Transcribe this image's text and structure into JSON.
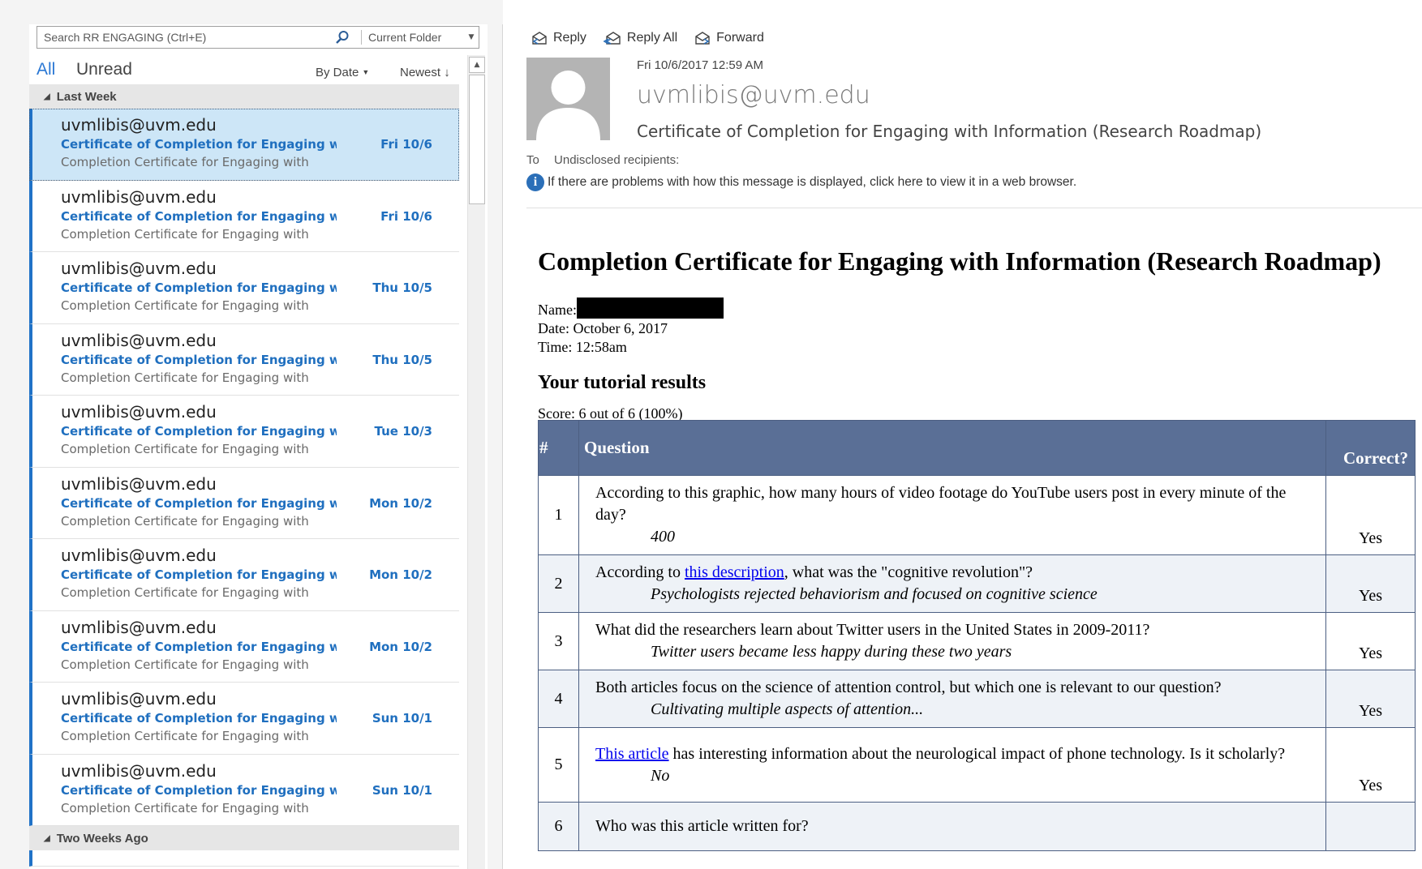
{
  "search": {
    "placeholder": "Search RR ENGAGING (Ctrl+E)",
    "scope": "Current Folder"
  },
  "filters": {
    "all": "All",
    "unread": "Unread",
    "sort_by": "By Date",
    "sort_order": "Newest"
  },
  "groups": {
    "last_week": "Last Week",
    "two_weeks_ago": "Two Weeks Ago"
  },
  "messages": [
    {
      "sender": "uvmlibis@uvm.edu",
      "subject": "Certificate of Completion for Engaging with I...",
      "date": "Fri 10/6",
      "preview": "Completion Certificate for Engaging with"
    },
    {
      "sender": "uvmlibis@uvm.edu",
      "subject": "Certificate of Completion for Engaging with I...",
      "date": "Fri 10/6",
      "preview": "Completion Certificate for Engaging with"
    },
    {
      "sender": "uvmlibis@uvm.edu",
      "subject": "Certificate of Completion for Engaging with I...",
      "date": "Thu 10/5",
      "preview": "Completion Certificate for Engaging with"
    },
    {
      "sender": "uvmlibis@uvm.edu",
      "subject": "Certificate of Completion for Engaging with I...",
      "date": "Thu 10/5",
      "preview": "Completion Certificate for Engaging with"
    },
    {
      "sender": "uvmlibis@uvm.edu",
      "subject": "Certificate of Completion for Engaging with I...",
      "date": "Tue 10/3",
      "preview": "Completion Certificate for Engaging with"
    },
    {
      "sender": "uvmlibis@uvm.edu",
      "subject": "Certificate of Completion for Engaging with I...",
      "date": "Mon 10/2",
      "preview": "Completion Certificate for Engaging with"
    },
    {
      "sender": "uvmlibis@uvm.edu",
      "subject": "Certificate of Completion for Engaging with I...",
      "date": "Mon 10/2",
      "preview": "Completion Certificate for Engaging with"
    },
    {
      "sender": "uvmlibis@uvm.edu",
      "subject": "Certificate of Completion for Engaging with I...",
      "date": "Mon 10/2",
      "preview": "Completion Certificate for Engaging with"
    },
    {
      "sender": "uvmlibis@uvm.edu",
      "subject": "Certificate of Completion for Engaging with I...",
      "date": "Sun 10/1",
      "preview": "Completion Certificate for Engaging with"
    },
    {
      "sender": "uvmlibis@uvm.edu",
      "subject": "Certificate of Completion for Engaging with I...",
      "date": "Sun 10/1",
      "preview": "Completion Certificate for Engaging with"
    }
  ],
  "actions": {
    "reply": "Reply",
    "reply_all": "Reply All",
    "forward": "Forward"
  },
  "email": {
    "date": "Fri 10/6/2017 12:59 AM",
    "from": "uvmlibis@uvm.edu",
    "subject": "Certificate of Completion for Engaging with Information (Research Roadmap)",
    "to_label": "To",
    "to_value": "Undisclosed recipients:",
    "info_text": "If there are problems with how this message is displayed, click here to view it in a web browser."
  },
  "body": {
    "title": "Completion Certificate for Engaging with Information (Research Roadmap)",
    "name_label": "Name:",
    "date_line": "Date: October 6, 2017",
    "time_line": "Time: 12:58am",
    "results_heading": "Your tutorial results",
    "score": "Score: 6 out of 6 (100%)"
  },
  "table": {
    "headers": {
      "num": "#",
      "question": "Question",
      "correct": "Correct?"
    },
    "rows": [
      {
        "num": "1",
        "q_pre": "According to this graphic, how many hours of video footage do YouTube users post in every minute of the day?",
        "q_link": "",
        "q_post": "",
        "answer": "400",
        "correct": "Yes"
      },
      {
        "num": "2",
        "q_pre": "According to ",
        "q_link": "this description",
        "q_post": ", what was the \"cognitive revolution\"?",
        "answer": "Psychologists rejected behaviorism and focused on cognitive science",
        "correct": "Yes"
      },
      {
        "num": "3",
        "q_pre": "What did the researchers learn about Twitter users in the United States in 2009-2011?",
        "q_link": "",
        "q_post": "",
        "answer": "Twitter users became less happy during these two years",
        "correct": "Yes"
      },
      {
        "num": "4",
        "q_pre": "Both articles focus on the science of attention control, but which one is relevant to our question?",
        "q_link": "",
        "q_post": "",
        "answer": "Cultivating multiple aspects of attention...",
        "correct": "Yes"
      },
      {
        "num": "5",
        "q_pre": "",
        "q_link": "This article",
        "q_post": " has interesting information about the neurological impact of phone technology. Is it scholarly?",
        "answer": "No",
        "correct": "Yes"
      },
      {
        "num": "6",
        "q_pre": "Who was this article written for?",
        "q_link": "",
        "q_post": "",
        "answer": "",
        "correct": ""
      }
    ]
  },
  "colors": {
    "accent": "#2072c7",
    "selected_row": "#cde6f7",
    "table_header": "#5a6f96"
  }
}
